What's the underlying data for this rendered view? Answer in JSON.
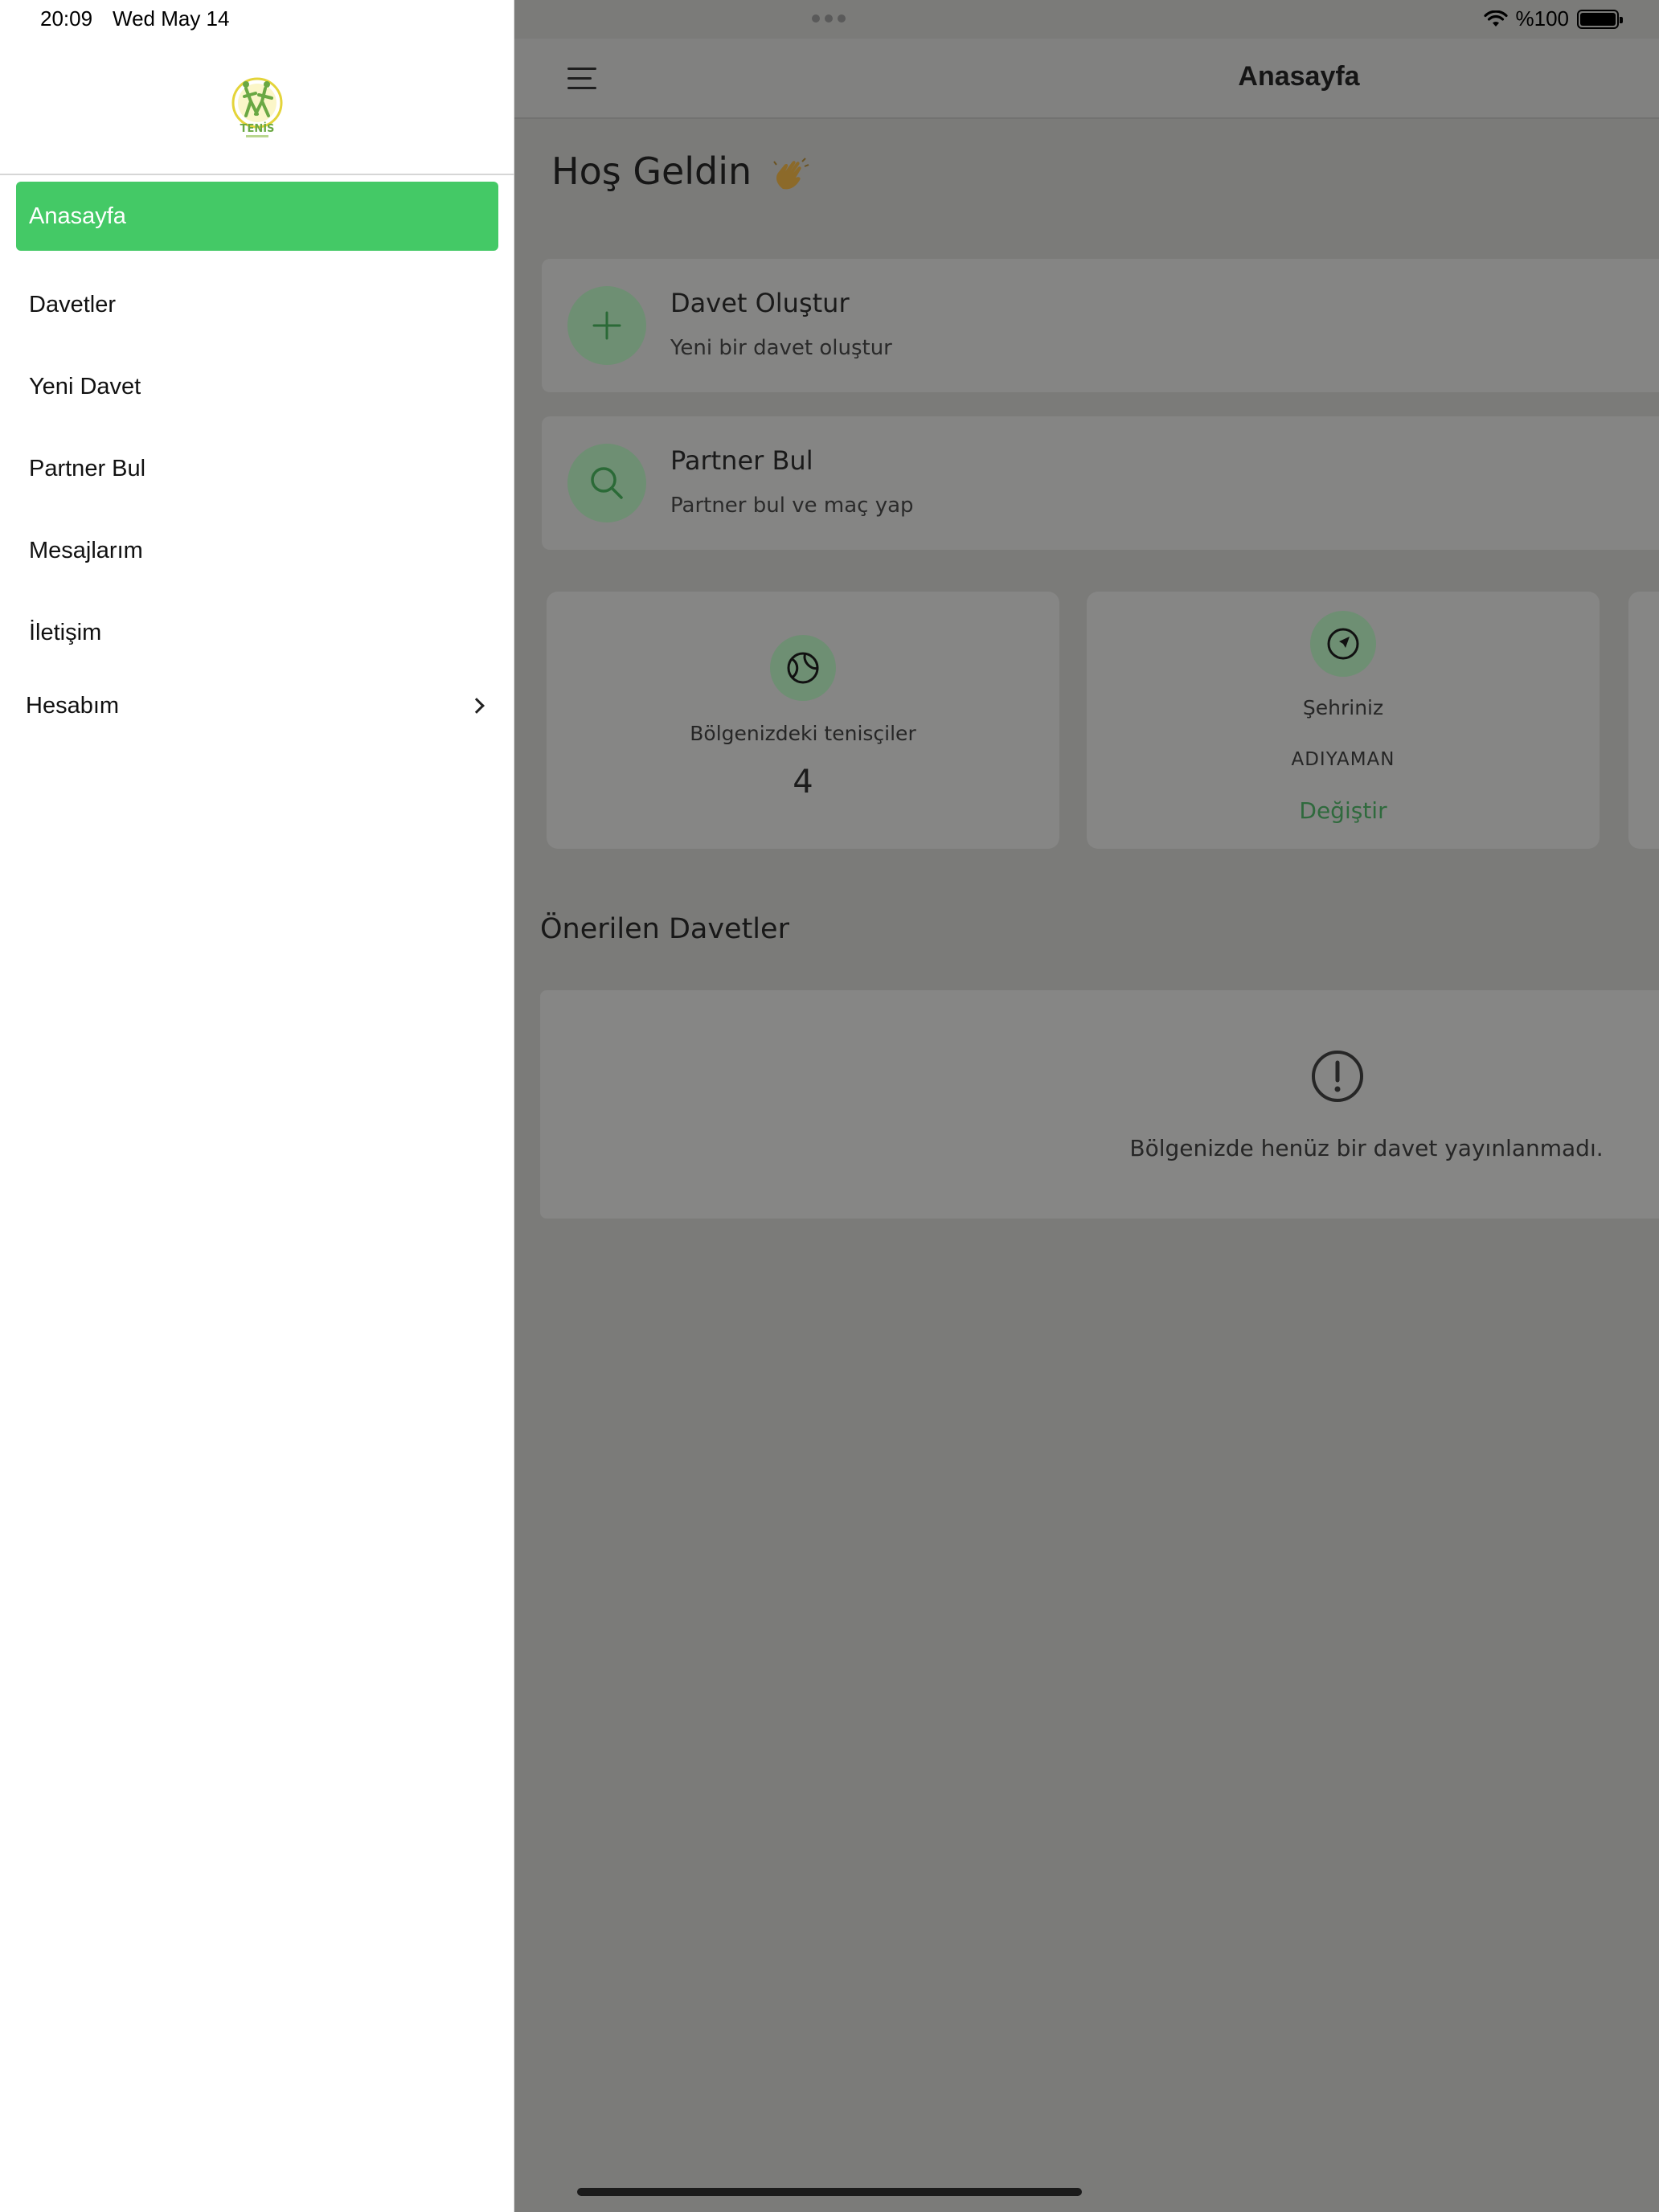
{
  "status_bar": {
    "time": "20:09",
    "date": "Wed May 14",
    "battery": "%100"
  },
  "sidebar": {
    "logo_text": "TENİS",
    "items": [
      {
        "label": "Anasayfa",
        "active": true
      },
      {
        "label": "Davetler"
      },
      {
        "label": "Yeni Davet"
      },
      {
        "label": "Partner Bul"
      },
      {
        "label": "Mesajlarım"
      },
      {
        "label": "İletişim"
      },
      {
        "label": "Hesabım"
      }
    ]
  },
  "header": {
    "title": "Anasayfa"
  },
  "main": {
    "greeting": "Hoş Geldin",
    "actions": [
      {
        "title": "Davet Oluştur",
        "subtitle": "Yeni bir davet oluştur",
        "icon": "plus-icon"
      },
      {
        "title": "Partner Bul",
        "subtitle": "Partner bul ve maç yap",
        "icon": "search-icon"
      }
    ],
    "stats": {
      "players_label": "Bölgenizdeki tenisçiler",
      "players_count": "4",
      "city_label": "Şehriniz",
      "city_value": "ADIYAMAN",
      "city_change": "Değiştir"
    },
    "recommended_title": "Önerilen Davetler",
    "empty_message": "Bölgenizde henüz bir davet yayınlanmadı."
  },
  "colors": {
    "accent": "#44c966",
    "link_green": "#2f6a3d",
    "overlay": "#7b7b79"
  }
}
